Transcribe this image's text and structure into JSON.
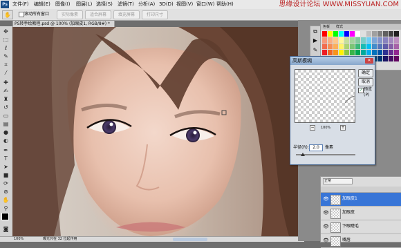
{
  "menubar": {
    "logo": "Ps",
    "items": [
      "文件(F)",
      "编辑(E)",
      "图像(I)",
      "图层(L)",
      "选择(S)",
      "滤镜(T)",
      "分析(A)",
      "3D(D)",
      "视图(V)",
      "窗口(W)",
      "帮助(H)"
    ],
    "watermark": "思缘设计论坛 WWW.MISSYUAN.COM"
  },
  "options": {
    "scroll_all_label": "滚动所有窗口",
    "buttons": [
      "实际像素",
      "适合屏幕",
      "填充屏幕",
      "打印尺寸"
    ]
  },
  "document": {
    "tab_title": "PS转手绘教程.psd @ 100% (加眼皮1, RGB/8#) *",
    "zoom": "100%",
    "status": "曝光只在 32 位起作用"
  },
  "swatches_panel": {
    "tabs": [
      "色板",
      "样式"
    ],
    "colors": [
      "#ff0000",
      "#ffff00",
      "#00ff00",
      "#00ffff",
      "#0000ff",
      "#ff00ff",
      "#ffffff",
      "#e0e0e0",
      "#c0c0c0",
      "#a0a0a0",
      "#808080",
      "#606060",
      "#404040",
      "#202020",
      "#f7977a",
      "#f9ad81",
      "#fdc68a",
      "#fff79a",
      "#c4df9b",
      "#a2d39c",
      "#82ca9d",
      "#7bcdc8",
      "#6ecff6",
      "#7ea7d8",
      "#8493ca",
      "#8882be",
      "#a187be",
      "#bc8dbf",
      "#f26c4f",
      "#f68e55",
      "#fbaf5c",
      "#fff467",
      "#acd372",
      "#7cc576",
      "#3bb878",
      "#1abbb4",
      "#00bff3",
      "#438cca",
      "#5574b9",
      "#605ca8",
      "#855fa8",
      "#a763a8",
      "#ed1c24",
      "#f26522",
      "#f7941d",
      "#fff200",
      "#8dc73f",
      "#39b54a",
      "#00a651",
      "#00a99d",
      "#00aeef",
      "#0072bc",
      "#0054a6",
      "#2e3192",
      "#662d91",
      "#92278f",
      "#9e0b0f",
      "#a0410d",
      "#a3620a",
      "#aba000",
      "#598527",
      "#1a7b30",
      "#007236",
      "#00746b",
      "#0076a3",
      "#004a80",
      "#003471",
      "#1b1464",
      "#440e62",
      "#630460"
    ]
  },
  "dialog": {
    "title": "高斯模糊",
    "ok": "确定",
    "cancel": "取消",
    "preview_label": "预览(P)",
    "preview_checked": true,
    "zoom_value": "100%",
    "zoom_minus": "−",
    "zoom_plus": "+",
    "radius_label": "半径(R):",
    "radius_value": "2.0",
    "radius_unit": "像素",
    "radius_slider": 0.12
  },
  "layers": {
    "mode": "正常",
    "items": [
      {
        "name": "加眼皮1",
        "selected": true
      },
      {
        "name": "加眼皮",
        "selected": false
      },
      {
        "name": "下眼睫毛",
        "selected": false
      },
      {
        "name": "嘴唇",
        "selected": false
      }
    ]
  },
  "tools": [
    "move-tool",
    "marquee-tool",
    "lasso-tool",
    "quick-select-tool",
    "crop-tool",
    "eyedropper-tool",
    "healing-tool",
    "brush-tool",
    "stamp-tool",
    "history-brush-tool",
    "eraser-tool",
    "gradient-tool",
    "blur-tool",
    "dodge-tool",
    "pen-tool",
    "type-tool",
    "path-select-tool",
    "shape-tool",
    "3d-rotate-tool",
    "3d-orbit-tool",
    "hand-tool",
    "zoom-tool"
  ]
}
